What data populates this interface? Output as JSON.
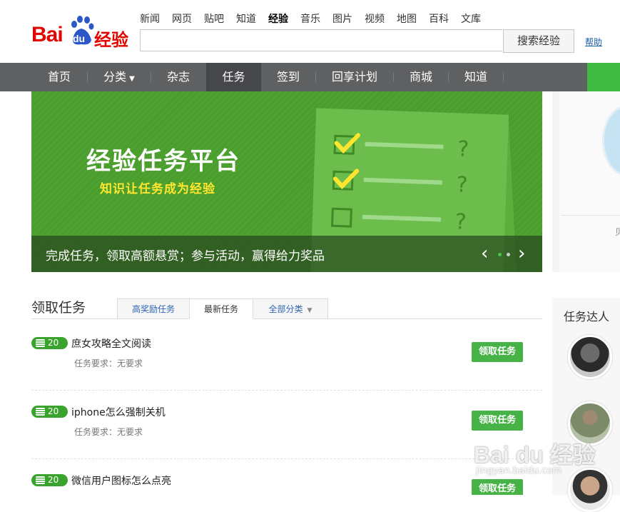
{
  "brand": {
    "bai": "Bai",
    "du": "du",
    "jingyan": "经验",
    "color": "#e10601"
  },
  "topnav": {
    "items": [
      "新闻",
      "网页",
      "贴吧",
      "知道",
      "经验",
      "音乐",
      "图片",
      "视频",
      "地图",
      "百科",
      "文库"
    ],
    "active": "经验"
  },
  "search": {
    "value": "",
    "button": "搜索经验",
    "help": "帮助"
  },
  "mainnav": {
    "items": [
      "首页",
      "分类",
      "杂志",
      "任务",
      "签到",
      "回享计划",
      "商城",
      "知道"
    ],
    "active": "任务",
    "dropdown_icon": "chevron-down-icon"
  },
  "banner": {
    "title": "经验任务平台",
    "subtitle": "知识让任务成为经验",
    "caption": "完成任务，领取高额悬赏；参与活动，赢得给力奖品",
    "prev": "‹",
    "next": "›",
    "slides": 3,
    "current_slide": 1
  },
  "right_card": {
    "text": "贝"
  },
  "tasks": {
    "section_title": "领取任务",
    "tabs": [
      "高奖励任务",
      "最新任务",
      "全部分类"
    ],
    "selected_tab": "最新任务",
    "tab_dropdown_icon": "chevron-down-icon",
    "claim_label": "领取任务",
    "items": [
      {
        "reward": "20",
        "title": "庶女攻略全文阅读",
        "requirement": "任务要求：无要求"
      },
      {
        "reward": "20",
        "title": "iphone怎么强制关机",
        "requirement": "任务要求：无要求"
      },
      {
        "reward": "20",
        "title": "微信用户图标怎么点亮",
        "requirement": ""
      }
    ]
  },
  "experts": {
    "title": "任务达人"
  },
  "watermark": {
    "logo": "Bai du 经验",
    "url": "jingyan.baidu.com"
  },
  "colors": {
    "nav_bg": "#5f6062",
    "banner_green": "#4a9e2c",
    "claim_green": "#47b347",
    "badge_green": "#3aa32d",
    "highlight_yellow": "#ffe62e"
  }
}
